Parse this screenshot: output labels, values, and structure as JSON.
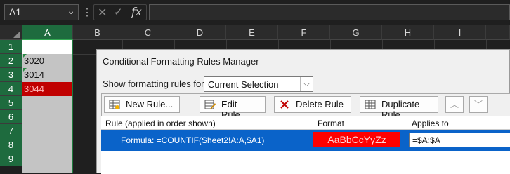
{
  "formula_bar": {
    "name_box": "A1",
    "cancel_icon": "✕",
    "enter_icon": "✓",
    "fx_label": "fx",
    "formula_value": ""
  },
  "columns": [
    "A",
    "B",
    "C",
    "D",
    "E",
    "F",
    "G",
    "H",
    "I"
  ],
  "rows": [
    "1",
    "2",
    "3",
    "4",
    "5",
    "6",
    "7",
    "8",
    "9"
  ],
  "cells_A": [
    "",
    "3020",
    "3014",
    "3044",
    "",
    "",
    "",
    "",
    ""
  ],
  "dialog": {
    "title": "Conditional Formatting Rules Manager",
    "show_label": "Show formatting rules for:",
    "show_value": "Current Selection",
    "buttons": {
      "new_rule": "New Rule...",
      "edit_rule": "Edit Rule...",
      "delete_rule": "Delete Rule",
      "duplicate_rule": "Duplicate Rule"
    },
    "table": {
      "headers": [
        "Rule (applied in order shown)",
        "Format",
        "Applies to"
      ],
      "rows": [
        {
          "rule": "Formula: =COUNTIF(Sheet2!A:A,$A1)",
          "format_preview": "AaBbCcYyZz",
          "applies_to": "=$A:$A"
        }
      ]
    }
  },
  "colors": {
    "selected_header": "#1e6b3e",
    "highlight_red": "#c00000",
    "selection_blue": "#0a63c9",
    "format_red": "#ff0000"
  }
}
